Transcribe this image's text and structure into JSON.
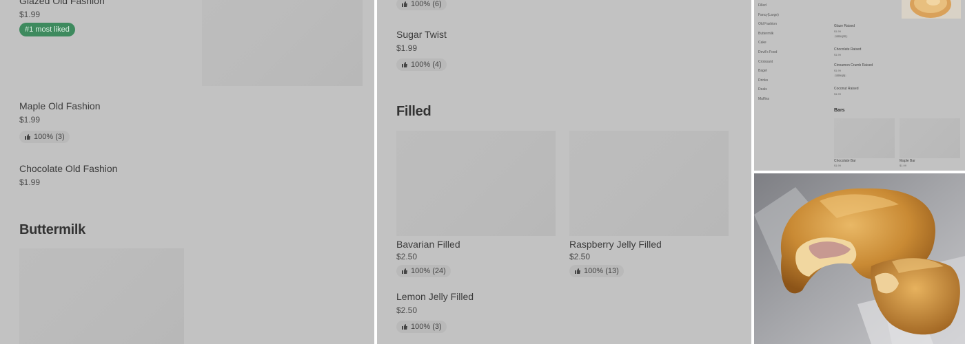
{
  "panel_left": {
    "top_item": {
      "name": "Glazed Old Fashion",
      "price": "$1.99",
      "badge": "#1 most liked"
    },
    "items": [
      {
        "name": "Maple Old Fashion",
        "price": "$1.99",
        "rating": "100% (3)"
      },
      {
        "name": "Chocolate Old Fashion",
        "price": "$1.99"
      }
    ],
    "section_title": "Buttermilk"
  },
  "panel_middle": {
    "top_rating": "100% (6)",
    "sugar_twist": {
      "name": "Sugar Twist",
      "price": "$1.99",
      "rating": "100% (4)"
    },
    "section_title": "Filled",
    "filled_items": [
      {
        "name": "Bavarian Filled",
        "price": "$2.50",
        "rating": "100% (24)"
      },
      {
        "name": "Raspberry Jelly Filled",
        "price": "$2.50",
        "rating": "100% (13)"
      }
    ],
    "lemon": {
      "name": "Lemon Jelly Filled",
      "price": "$2.50",
      "rating": "100% (3)"
    }
  },
  "panel_thumb": {
    "nav": [
      "Filled",
      "Fancy(Large)",
      "Old Fashion",
      "Buttermilk",
      "Cake",
      "Devil's Food",
      "Croissant",
      "Bagel",
      "Drinks",
      "Deals",
      "Muffins"
    ],
    "items": [
      {
        "name": "Glaze Raised",
        "price": "$1.99",
        "rating": "100% (32)"
      },
      {
        "name": "Chocolate Raised",
        "price": "$1.99"
      },
      {
        "name": "Cinnamon Crumb Raised",
        "price": "$1.99",
        "rating": "100% (5)"
      },
      {
        "name": "Coconut Raised",
        "price": "$1.99"
      }
    ],
    "section_title": "Bars",
    "bars": [
      {
        "name": "Chocolate Bar",
        "price": "$1.99"
      },
      {
        "name": "Maple Bar",
        "price": "$1.99"
      }
    ]
  },
  "photo": {
    "subject": "croissant"
  },
  "colors": {
    "overlay": "#c2c2c2",
    "badge_green": "#3e8a5e"
  }
}
